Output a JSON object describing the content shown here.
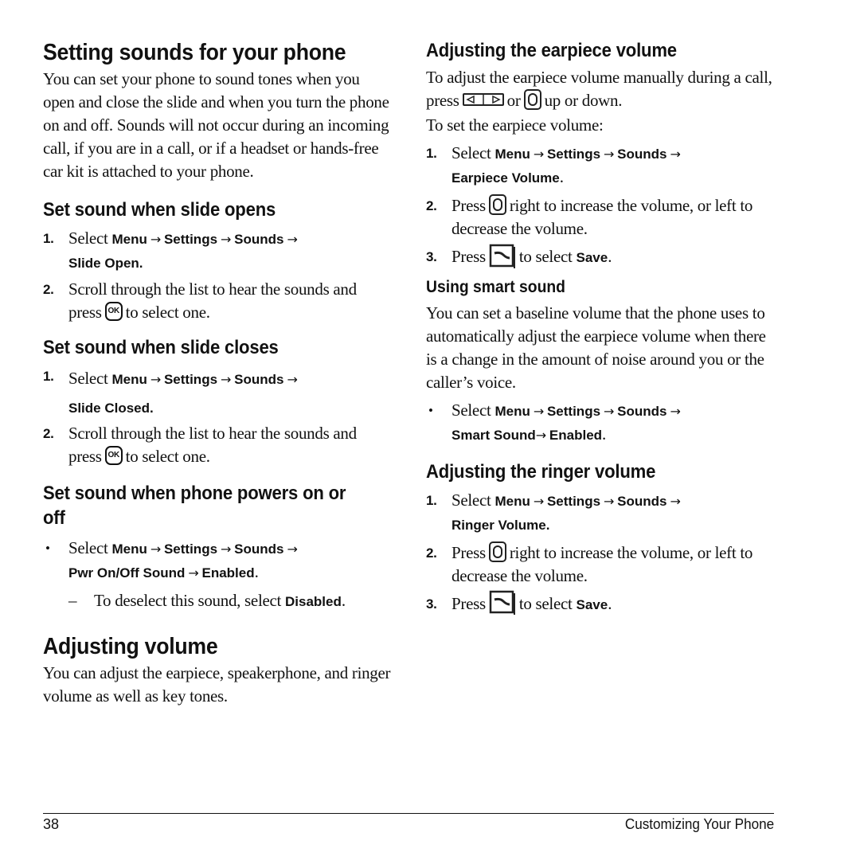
{
  "left": {
    "title": "Setting sounds for your phone",
    "intro": "You can set your phone to sound tones when you open and close the slide and when you turn the phone on and off. Sounds will not occur during an incoming call, if you are in a call, or if a headset or hands-free car kit is attached to your phone.",
    "slide_open": {
      "heading": "Set sound when slide opens",
      "step1": {
        "num": "1.",
        "select": "Select",
        "path": [
          "Menu",
          "Settings",
          "Sounds",
          "Slide Open."
        ]
      },
      "step2": {
        "num": "2.",
        "text_before": "Scroll through the list to hear the sounds and press",
        "icon": "ok-key-icon",
        "icon_label": "OK",
        "text_after": "to select one."
      }
    },
    "slide_close": {
      "heading": "Set sound when slide closes",
      "step1": {
        "num": "1.",
        "select": "Select",
        "path": [
          "Menu",
          "Settings",
          "Sounds",
          "Slide Closed."
        ]
      },
      "step2": {
        "num": "2.",
        "text_before": "Scroll through the list to hear the sounds and press",
        "icon": "ok-key-icon",
        "icon_label": "OK",
        "text_after": "to select one."
      }
    },
    "power": {
      "heading": "Set sound when phone powers on or off",
      "bullet": {
        "mark": "•",
        "select": "Select",
        "path": [
          "Menu",
          "Settings",
          "Sounds",
          "Pwr On/Off Sound",
          "Enabled"
        ],
        "end": "."
      },
      "sub": {
        "mark": "–",
        "text": "To deselect this sound, select",
        "key": "Disabled",
        "end": "."
      }
    },
    "adjusting": {
      "title": "Adjusting volume",
      "text": "You can adjust the earpiece, speakerphone, and ringer volume as well as key tones."
    }
  },
  "right": {
    "earpiece": {
      "heading": "Adjusting the earpiece volume",
      "text1_a": "To adjust the earpiece volume manually during a call, press",
      "text1_or": "or",
      "text1_b": "up or down.",
      "text2": "To set the earpiece volume:",
      "step1": {
        "num": "1.",
        "select": "Select",
        "path": [
          "Menu",
          "Settings",
          "Sounds",
          "Earpiece Volume"
        ],
        "end": "."
      },
      "step2": {
        "num": "2.",
        "text_before": "Press",
        "text_after": "right to increase the volume, or left to decrease the volume."
      },
      "step3": {
        "num": "3.",
        "text_before": "Press",
        "text_mid": "to select",
        "key": "Save",
        "end": "."
      }
    },
    "smart": {
      "heading": "Using smart sound",
      "text": "You can set a baseline volume that the phone uses to automatically adjust the earpiece volume when there is a change in the amount of noise around you or the caller’s voice.",
      "bullet": {
        "mark": "•",
        "select": "Select",
        "path": [
          "Menu",
          "Settings",
          "Sounds",
          "Smart Sound",
          "Enabled"
        ],
        "end": "."
      }
    },
    "ringer": {
      "heading": "Adjusting the ringer volume",
      "step1": {
        "num": "1.",
        "select": "Select",
        "path": [
          "Menu",
          "Settings",
          "Sounds",
          "Ringer Volume."
        ]
      },
      "step2": {
        "num": "2.",
        "text_before": "Press",
        "text_after": "right to increase the volume, or left to decrease the volume."
      },
      "step3": {
        "num": "3.",
        "text_before": "Press",
        "text_mid": "to select",
        "key": "Save",
        "end": "."
      }
    }
  },
  "footer": {
    "page_number": "38",
    "section": "Customizing Your Phone"
  },
  "arrow": "→"
}
